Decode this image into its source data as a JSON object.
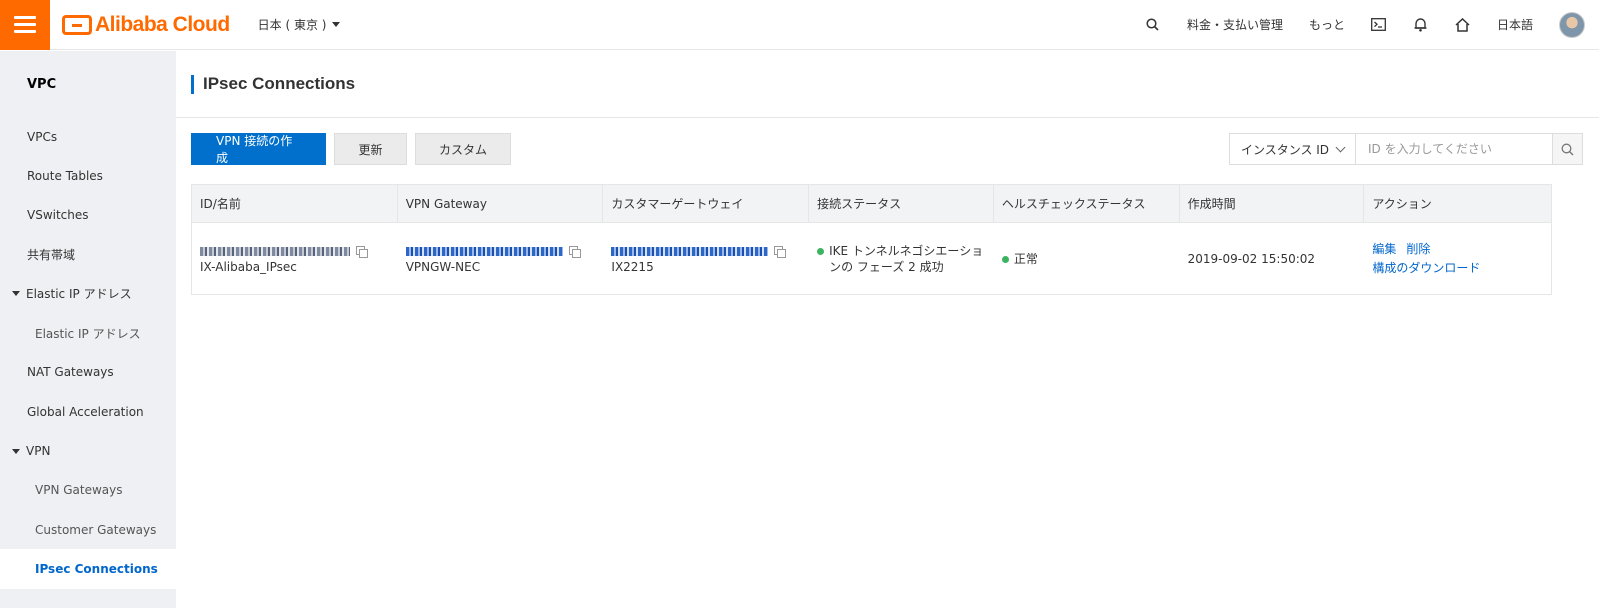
{
  "brand": {
    "name": "Alibaba Cloud",
    "color": "#ff6a00"
  },
  "header": {
    "region": "日本 ( 東京 )",
    "billing": "料金・支払い管理",
    "more": "もっと",
    "language": "日本語",
    "icons": [
      "search-icon",
      "terminal-icon",
      "bell-icon",
      "home-icon"
    ]
  },
  "sidebar": {
    "title": "VPC",
    "items": [
      {
        "label": "VPCs"
      },
      {
        "label": "Route Tables"
      },
      {
        "label": "VSwitches"
      },
      {
        "label": "共有帯域"
      },
      {
        "label": "Elastic IP アドレス"
      },
      {
        "label": "Elastic IP アドレス"
      },
      {
        "label": "NAT Gateways"
      },
      {
        "label": "Global Acceleration"
      },
      {
        "label": "VPN"
      },
      {
        "label": "VPN Gateways"
      },
      {
        "label": "Customer Gateways"
      },
      {
        "label": "IPsec Connections"
      }
    ]
  },
  "page": {
    "title": "IPsec Connections"
  },
  "toolbar": {
    "create": "VPN 接続の作成",
    "refresh": "更新",
    "custom": "カスタム",
    "search_field": "インスタンス ID",
    "search_placeholder": "ID を入力してください"
  },
  "table": {
    "columns": [
      "ID/名前",
      "VPN Gateway",
      "カスタマーゲートウェイ",
      "接続ステータス",
      "ヘルスチェックステータス",
      "作成時間",
      "アクション"
    ],
    "rows": [
      {
        "name": "IX-Alibaba_IPsec",
        "vpn_gateway": "VPNGW-NEC",
        "customer_gateway": "IX2215",
        "connection_status": "IKE トンネルネゴシエーションの フェーズ 2 成功",
        "health_status": "正常",
        "created": "2019-09-02 15:50:02",
        "edit": "編集",
        "delete": "削除",
        "download": "構成のダウンロード"
      }
    ]
  },
  "colors": {
    "primary": "#0070cc",
    "link": "#0066cc",
    "ok": "#3bb35f"
  }
}
